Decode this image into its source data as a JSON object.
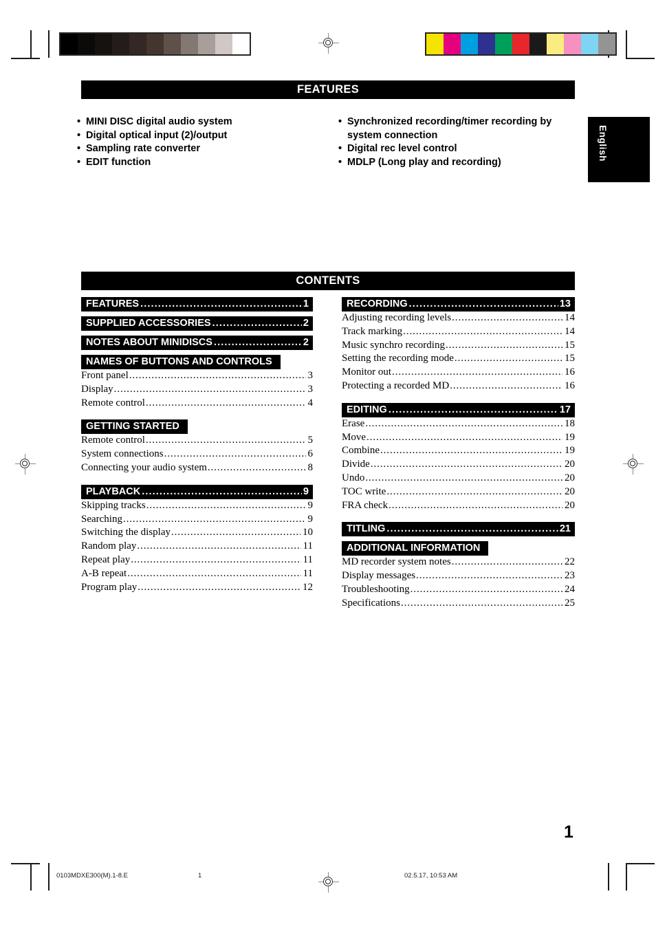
{
  "document": {
    "page_number": "1",
    "language_tab": "English"
  },
  "features": {
    "header": "FEATURES",
    "left_items": [
      "MINI DISC digital audio system",
      "Digital optical input (2)/output",
      "Sampling rate converter",
      "EDIT function"
    ],
    "right_items": [
      "Synchronized recording/timer recording by system connection",
      "Digital rec level control",
      "MDLP (Long play and recording)"
    ]
  },
  "contents": {
    "header": "CONTENTS",
    "left_column": [
      {
        "type": "bar",
        "label": "FEATURES",
        "page": "1"
      },
      {
        "type": "bar",
        "label": "SUPPLIED ACCESSORIES",
        "page": "2"
      },
      {
        "type": "bar",
        "label": "NOTES ABOUT MINIDISCS",
        "page": "2"
      },
      {
        "type": "bar",
        "label": "NAMES OF BUTTONS AND CONTROLS",
        "page": ""
      },
      {
        "type": "entry",
        "label": "Front panel",
        "page": "3"
      },
      {
        "type": "entry",
        "label": "Display",
        "page": "3"
      },
      {
        "type": "entry",
        "label": "Remote control",
        "page": "4"
      },
      {
        "type": "bar",
        "label": "GETTING STARTED",
        "page": ""
      },
      {
        "type": "entry",
        "label": "Remote control",
        "page": "5"
      },
      {
        "type": "entry",
        "label": "System connections",
        "page": "6"
      },
      {
        "type": "entry",
        "label": "Connecting your audio system",
        "page": "8"
      },
      {
        "type": "bar",
        "label": "PLAYBACK",
        "page": "9"
      },
      {
        "type": "entry",
        "label": "Skipping tracks",
        "page": "9"
      },
      {
        "type": "entry",
        "label": "Searching",
        "page": "9"
      },
      {
        "type": "entry",
        "label": "Switching the display",
        "page": "10"
      },
      {
        "type": "entry",
        "label": "Random play",
        "page": "11"
      },
      {
        "type": "entry",
        "label": "Repeat play",
        "page": "11"
      },
      {
        "type": "entry",
        "label": "A-B repeat",
        "page": "11"
      },
      {
        "type": "entry",
        "label": "Program play",
        "page": "12"
      }
    ],
    "right_column": [
      {
        "type": "bar",
        "label": "RECORDING",
        "page": "13"
      },
      {
        "type": "entry",
        "label": "Adjusting recording levels",
        "page": "14"
      },
      {
        "type": "entry",
        "label": "Track marking",
        "page": "14"
      },
      {
        "type": "entry",
        "label": "Music synchro recording",
        "page": "15"
      },
      {
        "type": "entry",
        "label": "Setting the recording mode",
        "page": "15"
      },
      {
        "type": "entry",
        "label": "Monitor out",
        "page": "16"
      },
      {
        "type": "entry",
        "label": "Protecting a recorded MD",
        "page": "16"
      },
      {
        "type": "bar",
        "label": "EDITING",
        "page": "17"
      },
      {
        "type": "entry",
        "label": "Erase",
        "page": "18"
      },
      {
        "type": "entry",
        "label": "Move",
        "page": "19"
      },
      {
        "type": "entry",
        "label": "Combine",
        "page": "19"
      },
      {
        "type": "entry",
        "label": "Divide",
        "page": "20"
      },
      {
        "type": "entry",
        "label": "Undo",
        "page": "20"
      },
      {
        "type": "entry",
        "label": "TOC write",
        "page": "20"
      },
      {
        "type": "entry",
        "label": "FRA check",
        "page": "20"
      },
      {
        "type": "bar",
        "label": "TITLING",
        "page": "21"
      },
      {
        "type": "bar",
        "label": "ADDITIONAL INFORMATION",
        "page": ""
      },
      {
        "type": "entry",
        "label": "MD recorder system notes",
        "page": "22"
      },
      {
        "type": "entry",
        "label": "Display messages",
        "page": "23"
      },
      {
        "type": "entry",
        "label": "Troubleshooting",
        "page": "24"
      },
      {
        "type": "entry",
        "label": "Specifications",
        "page": "25"
      }
    ]
  },
  "print_footer": {
    "filename": "0103MDXE300(M).1-8.E",
    "sheet": "1",
    "timestamp": "02.5.17, 10:53 AM"
  },
  "print_marks": {
    "gray_wedge": [
      "#000000",
      "#0c0a09",
      "#17120f",
      "#241c18",
      "#332823",
      "#44352e",
      "#5f514a",
      "#847873",
      "#a89e9a",
      "#d0c8c5",
      "#ffffff"
    ],
    "color_bars": [
      "#f5e400",
      "#e4007f",
      "#00a0e0",
      "#2e3191",
      "#00a05a",
      "#e8262b",
      "#1a1a1a",
      "#faec80",
      "#f590c0",
      "#7fd4f2",
      "#949494"
    ]
  }
}
